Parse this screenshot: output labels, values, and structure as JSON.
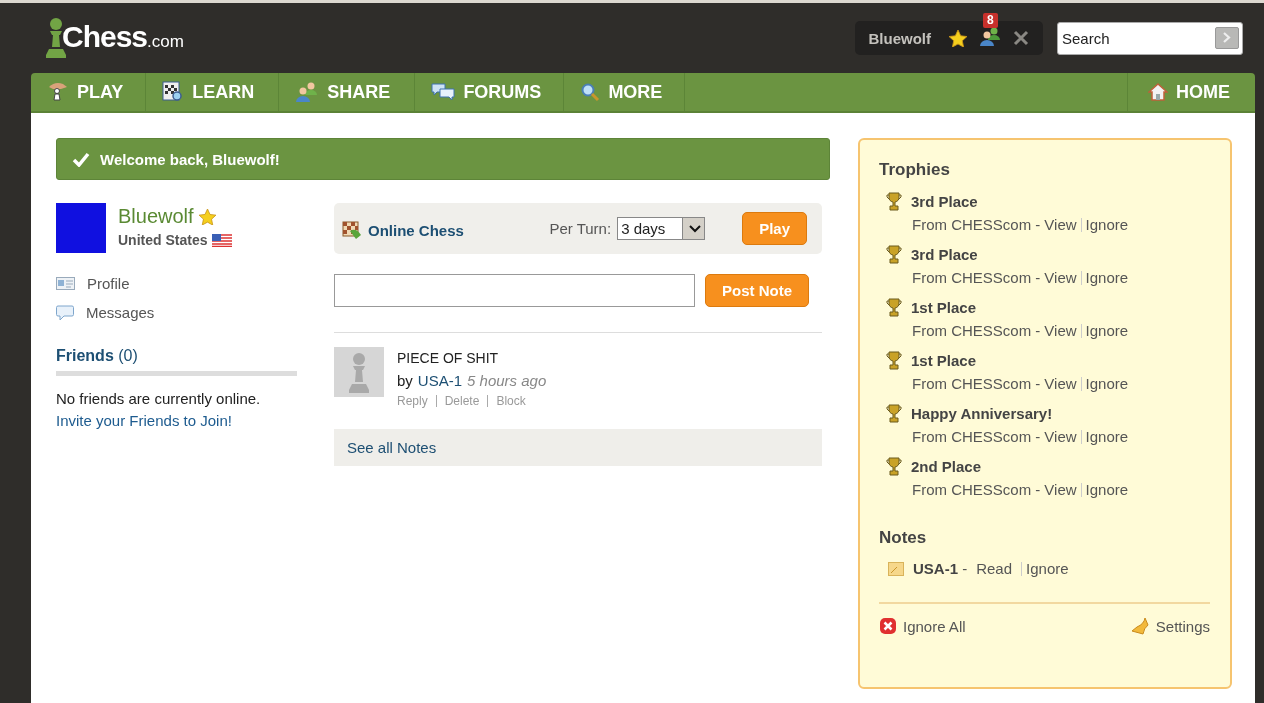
{
  "header": {
    "logo": {
      "text": "Chess",
      "suffix": ".com"
    },
    "user_bar": {
      "username": "Bluewolf",
      "badge": "8"
    },
    "search": {
      "placeholder": "Search"
    }
  },
  "nav": {
    "items": [
      {
        "label": "PLAY"
      },
      {
        "label": "LEARN"
      },
      {
        "label": "SHARE"
      },
      {
        "label": "FORUMS"
      },
      {
        "label": "MORE"
      }
    ],
    "home": "HOME"
  },
  "welcome": "Welcome back, Bluewolf!",
  "profile": {
    "username": "Bluewolf",
    "country": "United States",
    "links": [
      "Profile",
      "Messages"
    ]
  },
  "friends": {
    "title": "**Friends** (0)",
    "empty_text": "No friends are currently online.",
    "invite_link": "Invite your Friends to Join!"
  },
  "game": {
    "title": "Online Chess",
    "per_turn_label": "Per Turn:",
    "per_turn_value": "3 days",
    "play_button": "Play"
  },
  "note_form": {
    "button": "Post Note"
  },
  "notes": [
    {
      "title": "PIECE OF SHIT",
      "by": "by",
      "author": "USA-1",
      "time": "5 hours ago",
      "actions": [
        "Reply",
        "Delete",
        "Block"
      ]
    }
  ],
  "see_all": "See all Notes",
  "alerts": {
    "trophies_title": "Trophies",
    "trophies": [
      {
        "title": "3rd Place",
        "from": "From CHESScom -",
        "view": "View",
        "ignore": "Ignore"
      },
      {
        "title": "3rd Place",
        "from": "From CHESScom -",
        "view": "View",
        "ignore": "Ignore"
      },
      {
        "title": "1st Place",
        "from": "From CHESScom -",
        "view": "View",
        "ignore": "Ignore"
      },
      {
        "title": "1st Place",
        "from": "From CHESScom -",
        "view": "View",
        "ignore": "Ignore"
      },
      {
        "title": "Happy Anniversary!",
        "from": "From CHESScom -",
        "view": "View",
        "ignore": "Ignore"
      },
      {
        "title": "2nd Place",
        "from": "From CHESScom -",
        "view": "View",
        "ignore": "Ignore"
      }
    ],
    "notes_title": "Notes",
    "notes": [
      {
        "sender": "**USA-1** -",
        "read": "Read",
        "ignore": "Ignore"
      }
    ],
    "ignore_all": "Ignore All",
    "settings": "Settings"
  }
}
